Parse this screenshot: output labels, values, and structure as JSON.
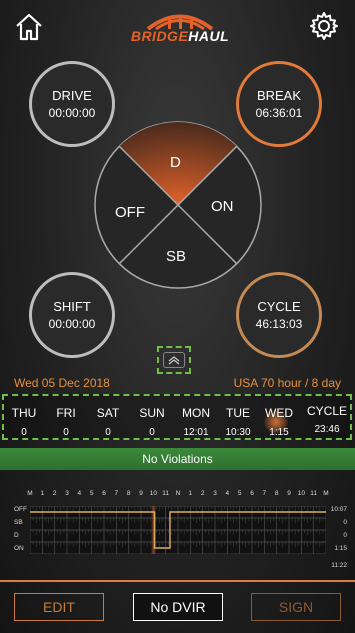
{
  "header": {
    "logo_text_part1": "BRIDGE",
    "logo_text_part2": "HAUL",
    "icons": [
      "home-icon",
      "gear-icon"
    ]
  },
  "dials": {
    "drive": {
      "label": "DRIVE",
      "value": "00:00:00"
    },
    "break": {
      "label": "BREAK",
      "value": "06:36:01"
    },
    "shift": {
      "label": "SHIFT",
      "value": "00:00:00"
    },
    "cycle": {
      "label": "CYCLE",
      "value": "46:13:03"
    }
  },
  "status_wheel": {
    "top": "D",
    "right": "ON",
    "bottom": "SB",
    "left": "OFF",
    "active": "D",
    "active_color": "#e2622a"
  },
  "date_row": {
    "date": "Wed 05 Dec 2018",
    "ruleset": "USA 70 hour / 8 day"
  },
  "week": [
    {
      "day": "THU",
      "hours": "0"
    },
    {
      "day": "FRI",
      "hours": "0"
    },
    {
      "day": "SAT",
      "hours": "0"
    },
    {
      "day": "SUN",
      "hours": "0"
    },
    {
      "day": "MON",
      "hours": "12:01"
    },
    {
      "day": "TUE",
      "hours": "10:30"
    },
    {
      "day": "WED",
      "hours": "1:15"
    },
    {
      "day": "CYCLE",
      "hours": "23:46"
    }
  ],
  "violations_text": "No Violations",
  "log": {
    "hours": [
      "M",
      "1",
      "2",
      "3",
      "4",
      "5",
      "6",
      "7",
      "8",
      "9",
      "10",
      "11",
      "N",
      "1",
      "2",
      "3",
      "4",
      "5",
      "6",
      "7",
      "8",
      "9",
      "10",
      "11",
      "M"
    ],
    "rows": [
      {
        "label": "OFF",
        "total": "10:07"
      },
      {
        "label": "SB",
        "total": "0"
      },
      {
        "label": "D",
        "total": "0"
      },
      {
        "label": "ON",
        "total": "1:15"
      }
    ],
    "grand_total": "11:22"
  },
  "footer": {
    "edit_label": "EDIT",
    "dvir_label": "No DVIR",
    "sign_label": "SIGN"
  },
  "colors": {
    "accent": "#e2622a",
    "highlight": "#6fc04a",
    "violations_bg": "#3b8a3b"
  }
}
